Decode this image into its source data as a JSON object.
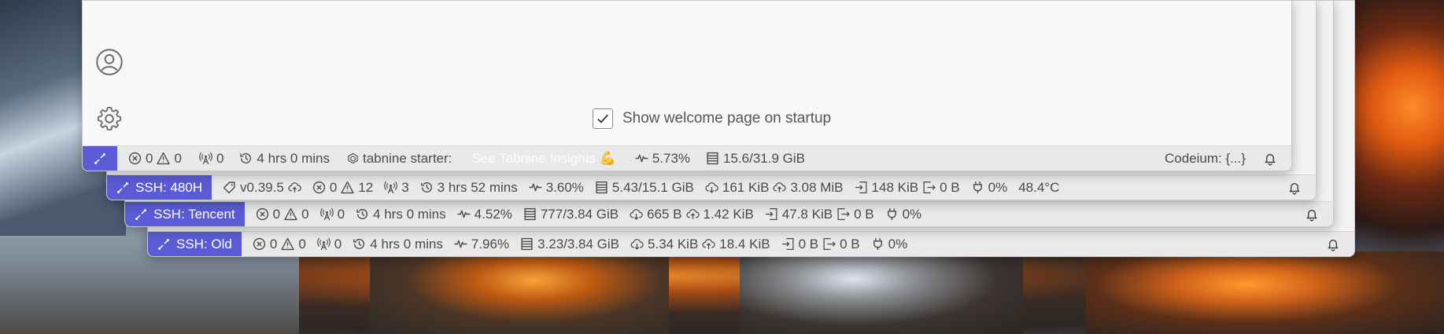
{
  "main": {
    "welcome_checkbox_label": "Show welcome page on startup",
    "welcome_checked": true,
    "status": {
      "errors": "0",
      "warnings": "0",
      "ports": "0",
      "time": "4 hrs 0 mins",
      "tabnine_label": "tabnine starter:",
      "tabnine_link": "See Tabnine Insights 💪",
      "cpu": "5.73%",
      "memory": "15.6/31.9 GiB",
      "codeium": "Codeium: {...}"
    }
  },
  "ssh_480h": {
    "remote_label": "SSH: 480H",
    "version": "v0.39.5",
    "errors": "0",
    "warnings": "12",
    "ports": "3",
    "time": "3 hrs 52 mins",
    "cpu": "3.60%",
    "memory": "5.43/15.1 GiB",
    "net_down": "161 KiB",
    "net_up": "3.08 MiB",
    "disk_in": "148 KiB",
    "disk_out": "0 B",
    "power": "0%",
    "temperature": "48.4°C"
  },
  "ssh_tencent": {
    "remote_label": "SSH: Tencent",
    "errors": "0",
    "warnings": "0",
    "ports": "0",
    "time": "4 hrs 0 mins",
    "cpu": "4.52%",
    "memory": "777/3.84 GiB",
    "net_down": "665 B",
    "net_up": "1.42 KiB",
    "disk_in": "47.8 KiB",
    "disk_out": "0 B",
    "power": "0%"
  },
  "ssh_old": {
    "remote_label": "SSH: Old",
    "errors": "0",
    "warnings": "0",
    "ports": "0",
    "time": "4 hrs 0 mins",
    "cpu": "7.96%",
    "memory": "3.23/3.84 GiB",
    "net_down": "5.34 KiB",
    "net_up": "18.4 KiB",
    "disk_in": "0 B",
    "disk_out": "0 B",
    "power": "0%"
  },
  "colors": {
    "remote_accent": "#5b5bd6",
    "statusbar_bg": "#e9e9e9"
  },
  "icons": [
    "remote-icon",
    "error-icon",
    "warning-icon",
    "ports-icon",
    "history-icon",
    "cpu-icon",
    "memory-icon",
    "cloud-download-icon",
    "cloud-upload-icon",
    "disk-in-icon",
    "disk-out-icon",
    "power-icon",
    "bell-icon",
    "account-icon",
    "gear-icon",
    "tabnine-icon",
    "tag-icon",
    "cloud-sync-icon",
    "check-icon"
  ]
}
